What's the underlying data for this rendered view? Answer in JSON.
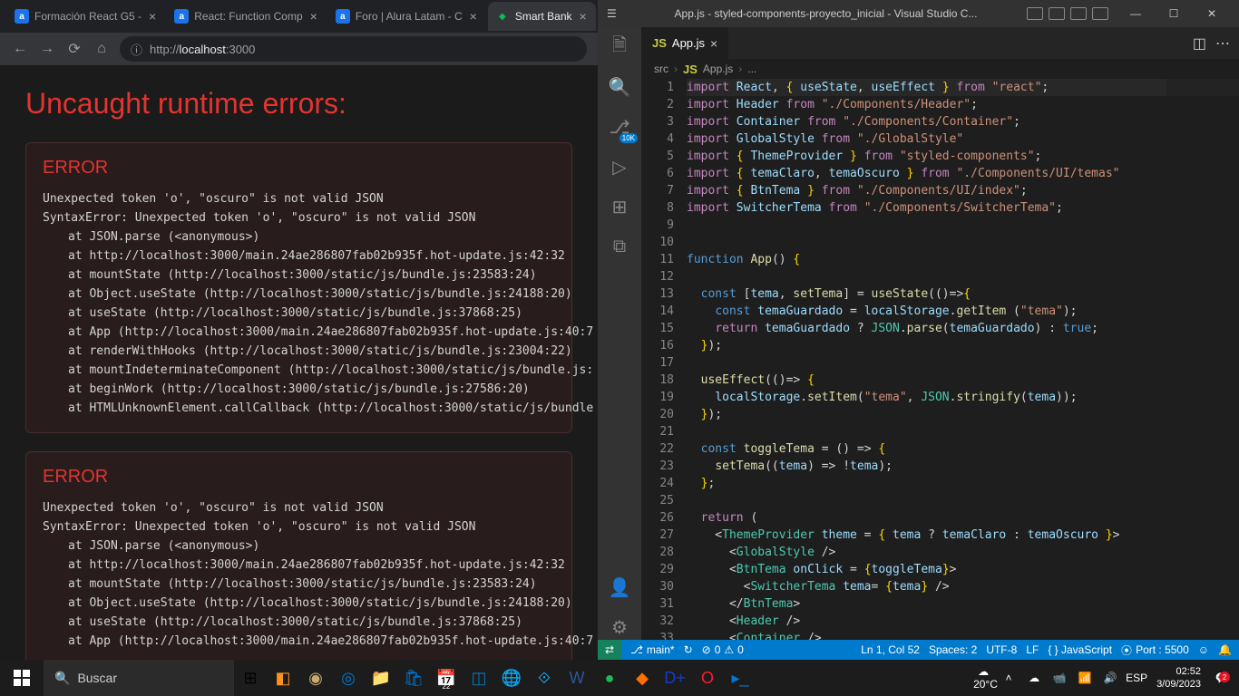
{
  "browser": {
    "tabs": [
      {
        "label": "Formación React G5 -",
        "favicon": "a"
      },
      {
        "label": "React: Function Comp",
        "favicon": "a"
      },
      {
        "label": "Foro | Alura Latam - C",
        "favicon": "a"
      },
      {
        "label": "Smart Bank",
        "favicon": "●",
        "active": true
      }
    ],
    "url": "http://localhost:3000",
    "page": {
      "title": "Uncaught runtime errors:",
      "errors": [
        {
          "heading": "ERROR",
          "summary": "Unexpected token 'o', \"oscuro\" is not valid JSON",
          "detail": "SyntaxError: Unexpected token 'o', \"oscuro\" is not valid JSON",
          "stack": [
            "at JSON.parse (<anonymous>)",
            "at http://localhost:3000/main.24ae286807fab02b935f.hot-update.js:42:32",
            "at mountState (http://localhost:3000/static/js/bundle.js:23583:24)",
            "at Object.useState (http://localhost:3000/static/js/bundle.js:24188:20)",
            "at useState (http://localhost:3000/static/js/bundle.js:37868:25)",
            "at App (http://localhost:3000/main.24ae286807fab02b935f.hot-update.js:40:7",
            "at renderWithHooks (http://localhost:3000/static/js/bundle.js:23004:22)",
            "at mountIndeterminateComponent (http://localhost:3000/static/js/bundle.js:",
            "at beginWork (http://localhost:3000/static/js/bundle.js:27586:20)",
            "at HTMLUnknownElement.callCallback (http://localhost:3000/static/js/bundle"
          ]
        },
        {
          "heading": "ERROR",
          "summary": "Unexpected token 'o', \"oscuro\" is not valid JSON",
          "detail": "SyntaxError: Unexpected token 'o', \"oscuro\" is not valid JSON",
          "stack": [
            "at JSON.parse (<anonymous>)",
            "at http://localhost:3000/main.24ae286807fab02b935f.hot-update.js:42:32",
            "at mountState (http://localhost:3000/static/js/bundle.js:23583:24)",
            "at Object.useState (http://localhost:3000/static/js/bundle.js:24188:20)",
            "at useState (http://localhost:3000/static/js/bundle.js:37868:25)",
            "at App (http://localhost:3000/main.24ae286807fab02b935f.hot-update.js:40:7"
          ]
        }
      ]
    }
  },
  "vscode": {
    "title": "App.js - styled-components-proyecto_inicial - Visual Studio C...",
    "tab": {
      "icon": "JS",
      "name": "App.js"
    },
    "breadcrumb": [
      "src",
      "App.js",
      "..."
    ],
    "code_lines": 33,
    "statusbar": {
      "branch": "main*",
      "sync": "↻",
      "errors": "0",
      "warnings": "0",
      "position": "Ln 1, Col 52",
      "spaces": "Spaces: 2",
      "encoding": "UTF-8",
      "eol": "LF",
      "lang": "{ } JavaScript",
      "port": "Port : 5500",
      "feedback": "☺",
      "bell": "🔔"
    }
  },
  "taskbar": {
    "search_placeholder": "Buscar",
    "weather": "20°C",
    "time": "02:52",
    "date": "3/09/2023",
    "lang": "ESP",
    "notif_count": "2"
  }
}
